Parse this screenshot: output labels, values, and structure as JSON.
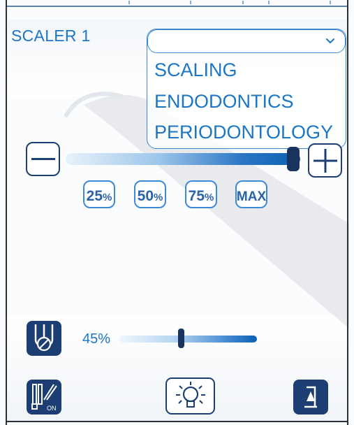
{
  "scaler": {
    "title": "SCALER 1",
    "dropdown": {
      "selected": "",
      "options": [
        "SCALING",
        "ENDODONTICS",
        "PERIODONTOLOGY"
      ]
    }
  },
  "power": {
    "level_fraction": 0.95,
    "presets": [
      {
        "num": "25",
        "unit": "%"
      },
      {
        "num": "50",
        "unit": "%"
      },
      {
        "num": "75",
        "unit": "%"
      },
      {
        "num": "MAX",
        "unit": ""
      }
    ]
  },
  "irrigation": {
    "level_label": "45%",
    "level_fraction": 0.45
  },
  "bottom_icons": {
    "toggle_on_label": "ON",
    "left": "instrument-on-icon",
    "center": "light-bulb-icon",
    "right": "chair-position-icon"
  },
  "colors": {
    "accent": "#1d76c3",
    "dark": "#1c3e73"
  }
}
